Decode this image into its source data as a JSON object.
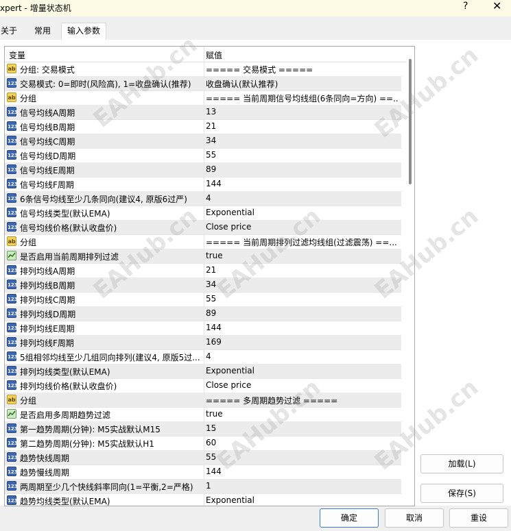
{
  "window": {
    "title": "xpert - 增量状态机",
    "help": "?",
    "close": "✕"
  },
  "tabs": [
    "关于",
    "常用",
    "输入参数"
  ],
  "table": {
    "headers": [
      "变量",
      "赋值"
    ],
    "rows": [
      {
        "type": "str",
        "name": "分组: 交易模式",
        "value": "===== 交易模式 ====="
      },
      {
        "type": "int",
        "name": "交易模式: 0=即时(风险高), 1=收盘确认(推荐)",
        "value": "收盘确认(默认推荐)"
      },
      {
        "type": "str",
        "name": "分组",
        "value": "===== 当前周期信号均线组(6条同向=方向) ==..."
      },
      {
        "type": "int",
        "name": "信号均线A周期",
        "value": "13"
      },
      {
        "type": "int",
        "name": "信号均线B周期",
        "value": "21"
      },
      {
        "type": "int",
        "name": "信号均线C周期",
        "value": "34"
      },
      {
        "type": "int",
        "name": "信号均线D周期",
        "value": "55"
      },
      {
        "type": "int",
        "name": "信号均线E周期",
        "value": "89"
      },
      {
        "type": "int",
        "name": "信号均线F周期",
        "value": "144"
      },
      {
        "type": "int",
        "name": "6条信号均线至少几条同向(建议4, 原版6过严)",
        "value": "4"
      },
      {
        "type": "int",
        "name": "信号均线类型(默认EMA)",
        "value": "Exponential"
      },
      {
        "type": "int",
        "name": "信号均线价格(默认收盘价)",
        "value": "Close price"
      },
      {
        "type": "str",
        "name": "分组",
        "value": "===== 当前周期排列过滤均线组(过滤震荡) ==..."
      },
      {
        "type": "bool",
        "name": "是否启用当前周期排列过滤",
        "value": "true"
      },
      {
        "type": "int",
        "name": "排列均线A周期",
        "value": "21"
      },
      {
        "type": "int",
        "name": "排列均线B周期",
        "value": "34"
      },
      {
        "type": "int",
        "name": "排列均线C周期",
        "value": "55"
      },
      {
        "type": "int",
        "name": "排列均线D周期",
        "value": "89"
      },
      {
        "type": "int",
        "name": "排列均线E周期",
        "value": "144"
      },
      {
        "type": "int",
        "name": "排列均线F周期",
        "value": "169"
      },
      {
        "type": "int",
        "name": "5组相邻均线至少几组同向排列(建议4, 原版5过...",
        "value": "4"
      },
      {
        "type": "int",
        "name": "排列均线类型(默认EMA)",
        "value": "Exponential"
      },
      {
        "type": "int",
        "name": "排列均线价格(默认收盘价)",
        "value": "Close price"
      },
      {
        "type": "str",
        "name": "分组",
        "value": "===== 多周期趋势过滤 ====="
      },
      {
        "type": "bool",
        "name": "是否启用多周期趋势过滤",
        "value": "true"
      },
      {
        "type": "int",
        "name": "第一趋势周期(分钟): M5实战默认M15",
        "value": "15"
      },
      {
        "type": "int",
        "name": "第二趋势周期(分钟): M5实战默认H1",
        "value": "60"
      },
      {
        "type": "int",
        "name": "趋势快线周期",
        "value": "55"
      },
      {
        "type": "int",
        "name": "趋势慢线周期",
        "value": "144"
      },
      {
        "type": "int",
        "name": "两周期至少几个快线斜率同向(1=平衡,2=严格)",
        "value": "1"
      },
      {
        "type": "int",
        "name": "趋势均线类型(默认EMA)",
        "value": "Exponential"
      }
    ]
  },
  "icons": {
    "int": "123",
    "str": "ab",
    "bool": ""
  },
  "buttons": {
    "load": "加载(L)",
    "save": "保存(S)",
    "ok": "确定",
    "cancel": "取消",
    "reset": "重设"
  },
  "watermark": "EAHub.cn"
}
